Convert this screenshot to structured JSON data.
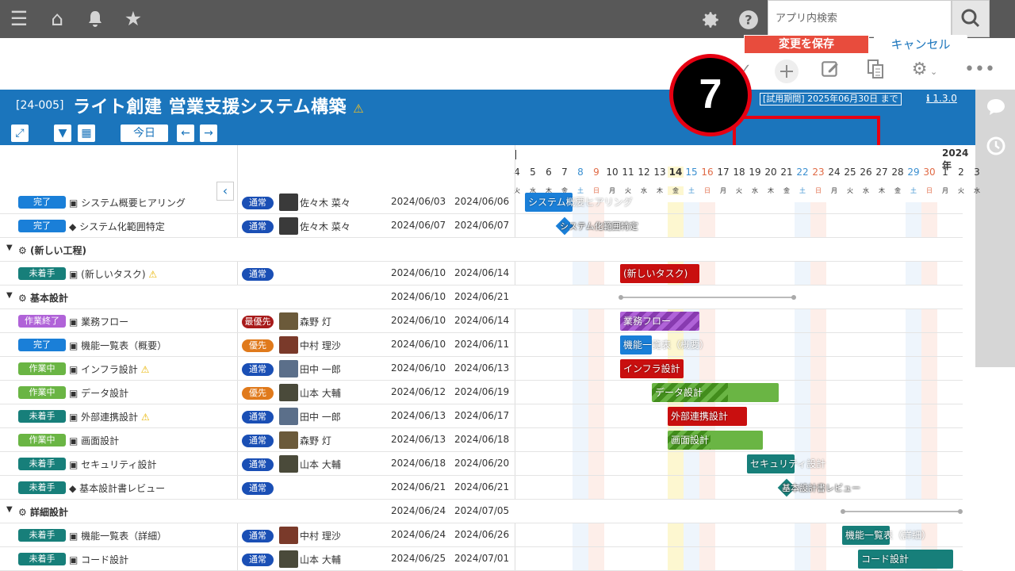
{
  "topbar": {
    "menu_icon": "hamburger-icon",
    "home_icon": "home-icon",
    "bell_icon": "bell-icon",
    "star_icon": "star-icon",
    "search_placeholder": "アプリ内検索"
  },
  "project": {
    "code": "[24-005]",
    "title": "ライト創建 営業支援システム構築",
    "trial": "[試用期間] 2025年06月30日 まで",
    "version": "1.3.0"
  },
  "buttons": {
    "today": "今日",
    "save": "変更を保存",
    "cancel": "キャンセル",
    "prev": "←",
    "next": "→"
  },
  "annotation": {
    "step": "7"
  },
  "calendar": {
    "month_label": "2024年",
    "days": [
      "4",
      "5",
      "6",
      "7",
      "8",
      "9",
      "10",
      "11",
      "12",
      "13",
      "14",
      "15",
      "16",
      "17",
      "18",
      "19",
      "20",
      "21",
      "22",
      "23",
      "24",
      "25",
      "26",
      "27",
      "28",
      "29",
      "30",
      "1",
      "2",
      "3"
    ],
    "weekdays": [
      "火",
      "水",
      "木",
      "金",
      "土",
      "日",
      "月",
      "火",
      "水",
      "木",
      "金",
      "土",
      "日",
      "月",
      "火",
      "水",
      "木",
      "金",
      "土",
      "日",
      "月",
      "火",
      "水",
      "木",
      "金",
      "土",
      "日",
      "月",
      "火",
      "水"
    ]
  },
  "rows": [
    {
      "type": "task",
      "status": "完了",
      "name": "システム概要ヒアリング",
      "prio": "通常",
      "person": "佐々木 菜々",
      "start": "2024/06/03",
      "end": "2024/06/06"
    },
    {
      "type": "task",
      "status": "完了",
      "name": "システム化範囲特定",
      "prio": "通常",
      "person": "佐々木 菜々",
      "start": "2024/06/07",
      "end": "2024/06/07"
    },
    {
      "type": "group",
      "name": "(新しい工程)",
      "start": "",
      "end": ""
    },
    {
      "type": "task",
      "status": "未着手",
      "name": "(新しいタスク)",
      "prio": "通常",
      "person": "",
      "start": "2024/06/10",
      "end": "2024/06/14"
    },
    {
      "type": "group",
      "name": "基本設計",
      "start": "2024/06/10",
      "end": "2024/06/21"
    },
    {
      "type": "task",
      "status": "作業終了",
      "name": "業務フロー",
      "prio": "最優先",
      "person": "森野 灯",
      "start": "2024/06/10",
      "end": "2024/06/14"
    },
    {
      "type": "task",
      "status": "完了",
      "name": "機能一覧表（概要）",
      "prio": "優先",
      "person": "中村 理沙",
      "start": "2024/06/10",
      "end": "2024/06/11"
    },
    {
      "type": "task",
      "status": "作業中",
      "name": "インフラ設計",
      "prio": "通常",
      "person": "田中 一郎",
      "start": "2024/06/10",
      "end": "2024/06/13"
    },
    {
      "type": "task",
      "status": "作業中",
      "name": "データ設計",
      "prio": "優先",
      "person": "山本 大輔",
      "start": "2024/06/12",
      "end": "2024/06/19"
    },
    {
      "type": "task",
      "status": "未着手",
      "name": "外部連携設計",
      "prio": "通常",
      "person": "田中 一郎",
      "start": "2024/06/13",
      "end": "2024/06/17"
    },
    {
      "type": "task",
      "status": "作業中",
      "name": "画面設計",
      "prio": "通常",
      "person": "森野 灯",
      "start": "2024/06/13",
      "end": "2024/06/18"
    },
    {
      "type": "task",
      "status": "未着手",
      "name": "セキュリティ設計",
      "prio": "通常",
      "person": "山本 大輔",
      "start": "2024/06/18",
      "end": "2024/06/20"
    },
    {
      "type": "task",
      "status": "未着手",
      "name": "基本設計書レビュー",
      "prio": "通常",
      "person": "",
      "start": "2024/06/21",
      "end": "2024/06/21"
    },
    {
      "type": "group",
      "name": "詳細設計",
      "start": "2024/06/24",
      "end": "2024/07/05"
    },
    {
      "type": "task",
      "status": "未着手",
      "name": "機能一覧表（詳細）",
      "prio": "通常",
      "person": "中村 理沙",
      "start": "2024/06/24",
      "end": "2024/06/26"
    },
    {
      "type": "task",
      "status": "未着手",
      "name": "コード設計",
      "prio": "通常",
      "person": "山本 大輔",
      "start": "2024/06/25",
      "end": "2024/07/01"
    }
  ],
  "bars": [
    {
      "label": "システム概要ヒアリング"
    },
    {
      "label": "システム化範囲特定"
    },
    {
      "label": "(新しいタスク)"
    },
    {
      "label": "業務フロー"
    },
    {
      "label": "機能一覧表（概要）"
    },
    {
      "label": "インフラ設計"
    },
    {
      "label": "データ設計"
    },
    {
      "label": "外部連携設計"
    },
    {
      "label": "画面設計"
    },
    {
      "label": "セキュリティ設計"
    },
    {
      "label": "基本設計書レビュー"
    },
    {
      "label": "機能一覧表（詳細）"
    },
    {
      "label": "コード設計"
    }
  ],
  "colors": {
    "header": "#1b75bc",
    "save": "#e84c3d",
    "highlight": "#e60012",
    "teal": "#177f7a",
    "blue": "#1a7fd8",
    "green": "#6ab544",
    "red": "#c90f0f",
    "purple": "#b063d8",
    "prio_normal": "#1a4fb5",
    "prio_high": "#e07a1c",
    "prio_top": "#a81b1b"
  }
}
